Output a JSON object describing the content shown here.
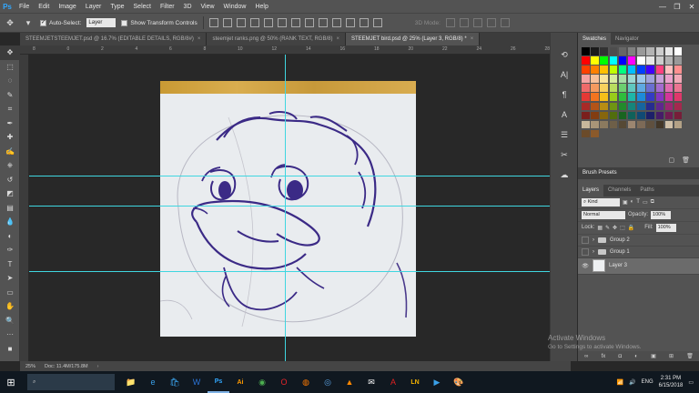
{
  "app": {
    "logo": "Ps",
    "menu": [
      "File",
      "Edit",
      "Image",
      "Layer",
      "Type",
      "Select",
      "Filter",
      "3D",
      "View",
      "Window",
      "Help"
    ]
  },
  "window_controls": [
    "—",
    "❐",
    "✕"
  ],
  "options_bar": {
    "auto_select_label": "Auto-Select:",
    "auto_select_checked": true,
    "auto_select_target": "Layer",
    "show_transform_label": "Show Transform Controls",
    "mode_3d_label": "3D Mode:"
  },
  "tabs": [
    {
      "label": "STEEMJETSTEEMJET.psd @ 16.7% (EDITABLE DETAILS, RGB/8#)",
      "active": false
    },
    {
      "label": "steemjet ranks.png @ 50% (RANK TEXT, RGB/8)",
      "active": false
    },
    {
      "label": "STEEMJET bird.psd @ 25% (Layer 3, RGB/8) *",
      "active": true
    }
  ],
  "ruler_top": [
    "8",
    "0",
    "2",
    "4",
    "6",
    "8",
    "10",
    "12",
    "14",
    "16",
    "18",
    "20",
    "22",
    "24",
    "26",
    "28"
  ],
  "tools": [
    {
      "name": "move-tool-icon",
      "glyph": "✥"
    },
    {
      "name": "marquee-tool-icon",
      "glyph": "⬚"
    },
    {
      "name": "lasso-tool-icon",
      "glyph": "◌"
    },
    {
      "name": "quick-select-tool-icon",
      "glyph": "✎"
    },
    {
      "name": "crop-tool-icon",
      "glyph": "⌗"
    },
    {
      "name": "eyedropper-tool-icon",
      "glyph": "✒"
    },
    {
      "name": "healing-brush-tool-icon",
      "glyph": "✚"
    },
    {
      "name": "brush-tool-icon",
      "glyph": "✍"
    },
    {
      "name": "clone-stamp-tool-icon",
      "glyph": "⎈"
    },
    {
      "name": "history-brush-tool-icon",
      "glyph": "↺"
    },
    {
      "name": "eraser-tool-icon",
      "glyph": "◩"
    },
    {
      "name": "gradient-tool-icon",
      "glyph": "▤"
    },
    {
      "name": "blur-tool-icon",
      "glyph": "💧"
    },
    {
      "name": "dodge-tool-icon",
      "glyph": "◐"
    },
    {
      "name": "pen-tool-icon",
      "glyph": "✑"
    },
    {
      "name": "type-tool-icon",
      "glyph": "T"
    },
    {
      "name": "path-select-tool-icon",
      "glyph": "➤"
    },
    {
      "name": "shape-tool-icon",
      "glyph": "▭"
    },
    {
      "name": "hand-tool-icon",
      "glyph": "✋"
    },
    {
      "name": "zoom-tool-icon",
      "glyph": "🔍"
    },
    {
      "name": "more-tools-icon",
      "glyph": "···"
    },
    {
      "name": "color-swatch-icon",
      "glyph": "■"
    }
  ],
  "status": {
    "zoom": "25%",
    "doc": "Doc: 11.4M/175.8M"
  },
  "right_icons": [
    {
      "name": "history-panel-icon",
      "glyph": "⟲"
    },
    {
      "name": "type-panel-icon",
      "glyph": "A|"
    },
    {
      "name": "paragraph-panel-icon",
      "glyph": "¶"
    },
    {
      "name": "character-panel-icon",
      "glyph": "A"
    },
    {
      "name": "properties-panel-icon",
      "glyph": "☰"
    },
    {
      "name": "brush-panel-icon",
      "glyph": "✂"
    },
    {
      "name": "libraries-panel-icon",
      "glyph": "☁"
    }
  ],
  "swatches_panel": {
    "tabs": [
      "Swatches",
      "Navigator"
    ],
    "rows": [
      [
        "#000000",
        "#1a1a1a",
        "#333333",
        "#4d4d4d",
        "#666666",
        "#808080",
        "#999999",
        "#b3b3b3",
        "#cccccc",
        "#e6e6e6",
        "#ffffff"
      ],
      [
        "#ff0000",
        "#ffff00",
        "#00ff00",
        "#00ffff",
        "#0000ff",
        "#ff00ff",
        "#ffffff",
        "#e6e6e6",
        "#cccccc",
        "#b3b3b3",
        "#999999"
      ],
      [
        "#ff4000",
        "#ff8000",
        "#ffbf00",
        "#bfff00",
        "#00ff80",
        "#00bfff",
        "#0040ff",
        "#4000ff",
        "#ff4080",
        "#ffc0c0",
        "#ff9090"
      ],
      [
        "#f5a3a3",
        "#f7c19a",
        "#f9e49b",
        "#d6ec9e",
        "#a6dda5",
        "#9bd9d3",
        "#9cc8ec",
        "#a0a3dd",
        "#c8a1d9",
        "#eaa3cc",
        "#f1a9b7"
      ],
      [
        "#ef6a6a",
        "#f49a5f",
        "#f7d15e",
        "#b9dd5f",
        "#6ccf70",
        "#5fc8bf",
        "#5fa9e2",
        "#6a6fd1",
        "#a46ccf",
        "#e06cb0",
        "#eb7592"
      ],
      [
        "#e53935",
        "#f27420",
        "#f5c01a",
        "#98cc1a",
        "#2fbd3c",
        "#1eb6a8",
        "#1e8bd9",
        "#343cc4",
        "#8436c2",
        "#d3369a",
        "#e0386b"
      ],
      [
        "#a82a27",
        "#b35418",
        "#b88d13",
        "#6f9513",
        "#228a2c",
        "#16857b",
        "#16659f",
        "#262c8f",
        "#60278e",
        "#9b2771",
        "#a4294e"
      ],
      [
        "#7a1f1c",
        "#823d11",
        "#86660e",
        "#516d0e",
        "#196420",
        "#10615a",
        "#104a74",
        "#1c2069",
        "#461c68",
        "#711c52",
        "#771e39"
      ],
      [
        "#c8b89c",
        "#a89578",
        "#8b7a5f",
        "#6e5f48",
        "#564935",
        "#9c8670",
        "#7d6a57",
        "#5f503f",
        "#433728",
        "#d0c0a8",
        "#b3a186"
      ],
      [
        "#6b4b2a",
        "#8b5a2b"
      ]
    ]
  },
  "brush_presets_label": "Brush Presets",
  "layers_panel": {
    "tabs": [
      "Layers",
      "Channels",
      "Paths"
    ],
    "kind_label": "Kind",
    "blend_mode": "Normal",
    "opacity_label": "Opacity:",
    "opacity_value": "100%",
    "lock_label": "Lock:",
    "fill_label": "Fill:",
    "fill_value": "100%",
    "layers": [
      {
        "name": "Group 2",
        "type": "group",
        "visible": false,
        "active": false
      },
      {
        "name": "Group 1",
        "type": "group",
        "visible": false,
        "active": false
      },
      {
        "name": "Layer 3",
        "type": "pixel",
        "visible": true,
        "active": true
      }
    ],
    "footer_icons": [
      "∞",
      "fx",
      "◘",
      "◐",
      "▣",
      "⊞",
      "🗑"
    ]
  },
  "watermark": {
    "line1": "Activate Windows",
    "line2": "Go to Settings to activate Windows."
  },
  "taskbar": {
    "start": "⊞",
    "search_placeholder": "",
    "apps": [
      {
        "name": "file-explorer-icon",
        "glyph": "📁",
        "color": "#f3c13a"
      },
      {
        "name": "edge-icon",
        "glyph": "e",
        "color": "#3aa0e8"
      },
      {
        "name": "store-icon",
        "glyph": "🛍",
        "color": "#3aa0e8"
      },
      {
        "name": "word-icon",
        "glyph": "W",
        "color": "#2b74d8"
      },
      {
        "name": "photoshop-icon",
        "glyph": "Ps",
        "color": "#31a8ff"
      },
      {
        "name": "illustrator-icon",
        "glyph": "Ai",
        "color": "#ff9a00"
      },
      {
        "name": "chrome-icon",
        "glyph": "◉",
        "color": "#4caf50"
      },
      {
        "name": "opera-icon",
        "glyph": "O",
        "color": "#e5252a"
      },
      {
        "name": "firefox-icon",
        "glyph": "◍",
        "color": "#ff7a00"
      },
      {
        "name": "globe-icon",
        "glyph": "◎",
        "color": "#5ba4e6"
      },
      {
        "name": "vlc-icon",
        "glyph": "▲",
        "color": "#ff8800"
      },
      {
        "name": "mail-icon",
        "glyph": "✉",
        "color": "#ffffff"
      },
      {
        "name": "acrobat-icon",
        "glyph": "A",
        "color": "#e02020"
      },
      {
        "name": "linkedin-icon",
        "glyph": "LN",
        "color": "#f5b300"
      },
      {
        "name": "media-icon",
        "glyph": "▶",
        "color": "#3aa0e8"
      },
      {
        "name": "paint-icon",
        "glyph": "🎨",
        "color": "#f28c28"
      }
    ],
    "language": "ENG",
    "time": "2:31 PM",
    "date": "6/15/2018"
  }
}
